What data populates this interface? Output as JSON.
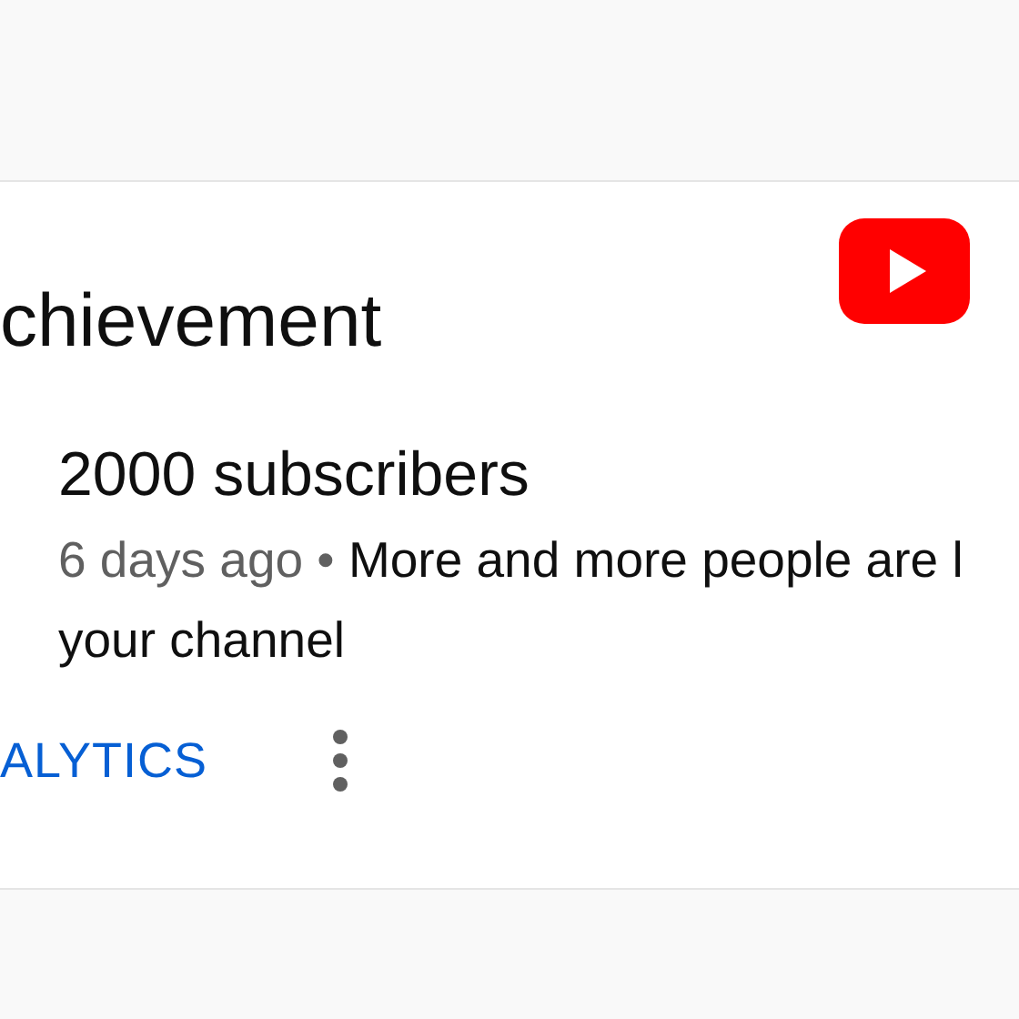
{
  "heading": "chievement",
  "logo": {
    "kind": "play"
  },
  "notification": {
    "title": "2000 subscribers",
    "time": "6 days ago",
    "separator": "•",
    "message_lines": [
      "More and more people are l",
      "your channel"
    ]
  },
  "actions": {
    "link": "ALYTICS"
  }
}
